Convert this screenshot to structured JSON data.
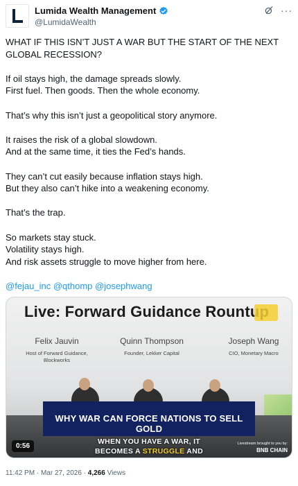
{
  "author": {
    "name": "Lumida Wealth Management",
    "handle": "@LumidaWealth"
  },
  "post": {
    "paragraphs": [
      "WHAT IF THIS ISN’T JUST A WAR BUT THE START OF THE NEXT GLOBAL RECESSION?",
      "If oil stays high, the damage spreads slowly.\nFirst fuel. Then goods. Then the whole economy.",
      "That’s why this isn’t just a geopolitical story anymore.",
      "It raises the risk of a global slowdown.\nAnd at the same time, it ties the Fed’s hands.",
      "They can’t cut easily because inflation stays high.\nBut they also can’t hike into a weakening economy.",
      "That’s the trap.",
      "So markets stay stuck.\nVolatility stays high.\nAnd risk assets struggle to move higher from here."
    ],
    "mentions": "@fejau_inc @qthomp @josephwang"
  },
  "video": {
    "banner_title": "Live: Forward Guidance Rountup",
    "speakers": [
      {
        "name": "Felix Jauvin",
        "role": "Host of Forward Guidance,\nBlockworks"
      },
      {
        "name": "Quinn Thompson",
        "role": "Founder, Lekker Capital"
      },
      {
        "name": "Joseph Wang",
        "role": "CIO, Monetary Macro"
      }
    ],
    "chyron": "WHY WAR CAN FORCE NATIONS TO SELL GOLD",
    "caption_line1": "WHEN YOU HAVE A WAR, IT",
    "caption_line2_pre": "BECOMES A ",
    "caption_line2_highlight": "STRUGGLE",
    "caption_line2_post": " AND",
    "duration": "0:56",
    "sponsor_text": "Livestream brought to you by:",
    "sponsor_brand": "BNB CHAIN"
  },
  "meta": {
    "time": "11:42 PM",
    "separator": " · ",
    "date": "Mar 27, 2026",
    "views_count": "4,266",
    "views_label": " Views"
  },
  "colors": {
    "accent": "#1d9bf0",
    "chyron_bg": "#12215f",
    "caption_highlight": "#f2d028"
  },
  "icons": [
    "verified-badge-icon",
    "grok-icon",
    "more-icon"
  ]
}
